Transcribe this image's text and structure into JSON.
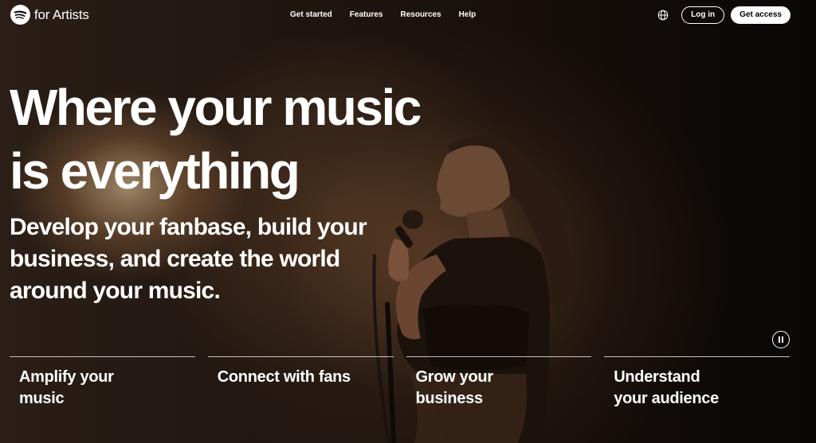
{
  "brand": {
    "logo_icon": "spotify-logo-icon",
    "name": "for Artists"
  },
  "nav": {
    "items": [
      {
        "label": "Get started"
      },
      {
        "label": "Features"
      },
      {
        "label": "Resources"
      },
      {
        "label": "Help"
      }
    ]
  },
  "header_actions": {
    "language_icon": "globe-icon",
    "login_label": "Log in",
    "get_access_label": "Get access"
  },
  "hero": {
    "headline_line1": "Where your music",
    "headline_line2": "is everything",
    "subhead": "Develop your fanbase, build your business, and create the world around your music.",
    "pause_icon": "pause-icon"
  },
  "tabs": [
    {
      "label": "Amplify your music"
    },
    {
      "label": "Connect with fans"
    },
    {
      "label": "Grow your business"
    },
    {
      "label": "Understand your audience"
    }
  ],
  "colors": {
    "text": "#ffffff",
    "button_bg": "#ffffff",
    "button_text": "#000000"
  }
}
